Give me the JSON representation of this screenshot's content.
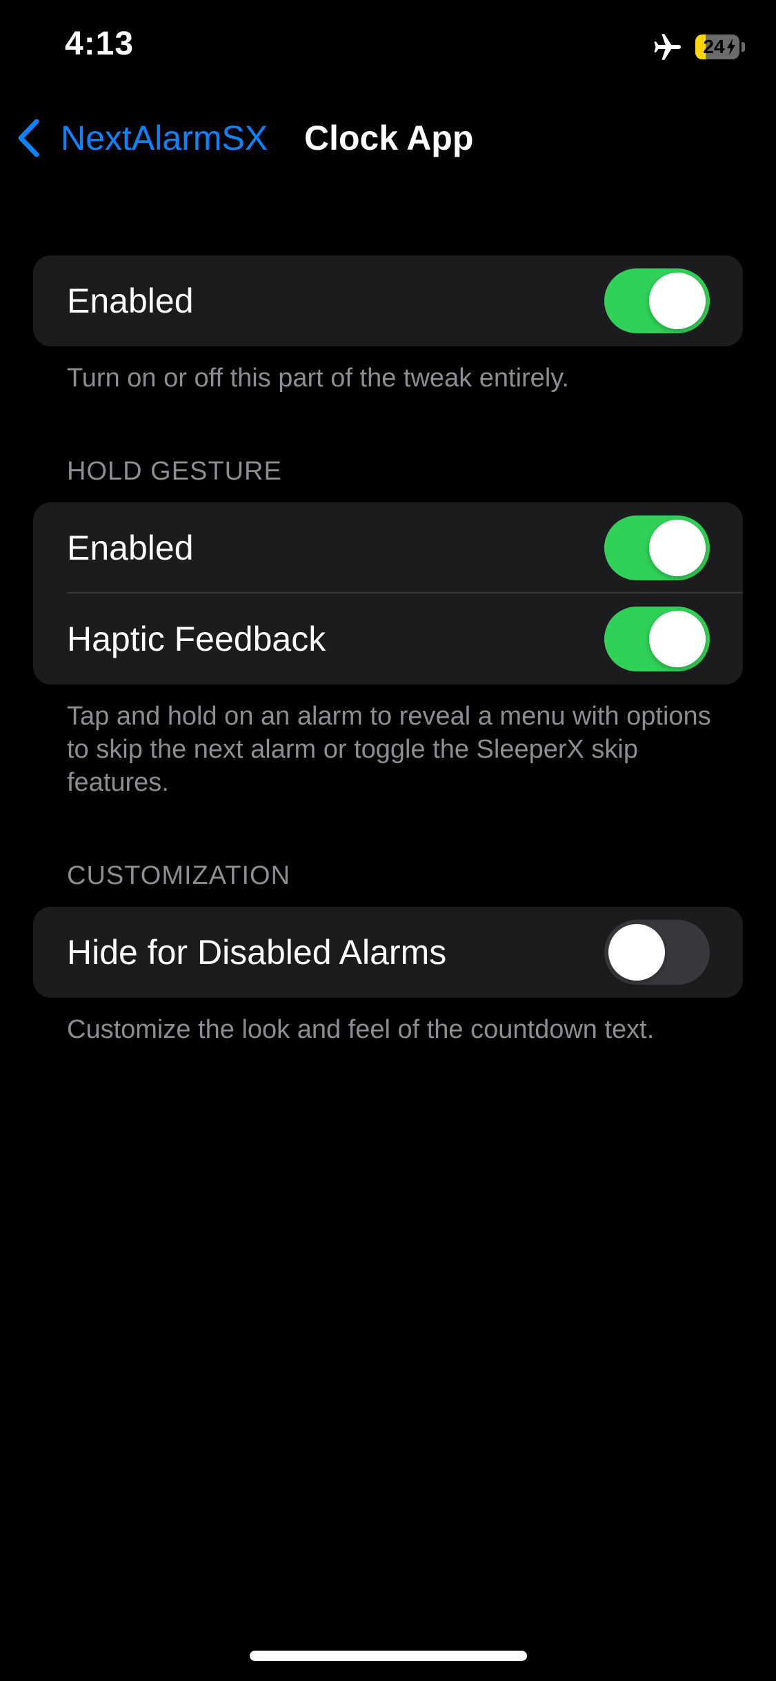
{
  "status_bar": {
    "time": "4:13",
    "battery_level": "24",
    "battery_fraction": 0.24,
    "icons": [
      "airplane-icon",
      "battery-charging-icon"
    ]
  },
  "nav": {
    "back_label": "NextAlarmSX",
    "title": "Clock App",
    "back_icon": "chevron-left-icon"
  },
  "sections": {
    "main": {
      "rows": [
        {
          "label": "Enabled",
          "on": true
        }
      ],
      "footer": "Turn on or off this part of the tweak entirely."
    },
    "hold_gesture": {
      "header": "HOLD GESTURE",
      "rows": [
        {
          "label": "Enabled",
          "on": true
        },
        {
          "label": "Haptic Feedback",
          "on": true
        }
      ],
      "footer": "Tap and hold on an alarm to reveal a menu with options to skip the next alarm or toggle the SleeperX skip features."
    },
    "customization": {
      "header": "CUSTOMIZATION",
      "rows": [
        {
          "label": "Hide for Disabled Alarms",
          "on": false
        }
      ],
      "footer": "Customize the look and feel of the countdown text."
    }
  },
  "colors": {
    "accent": "#0a84ff",
    "toggle_on": "#30d158",
    "toggle_off": "#39393d",
    "cell_background": "#1c1c1e",
    "secondary_text": "#8d8d93",
    "battery_fill": "#ffd60a"
  }
}
